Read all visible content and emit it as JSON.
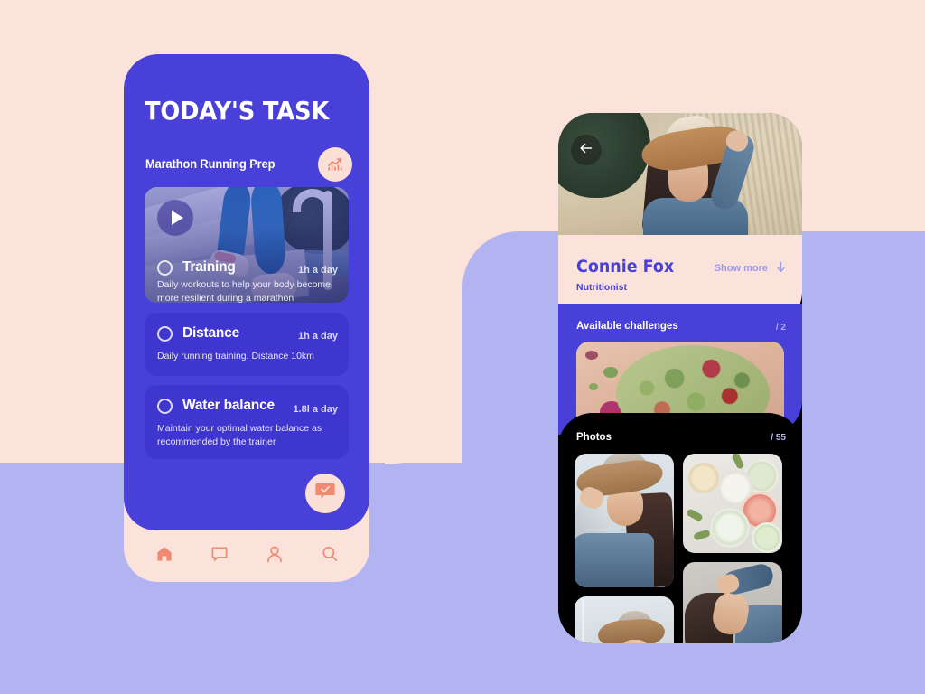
{
  "background": {
    "pink": "#FBE2DB",
    "lavender": "#B2B4F2"
  },
  "theme": {
    "indigo": "#4840D8",
    "indigo_card": "#3F35CF",
    "salmon": "#F08A70",
    "cream": "#FBE0D7",
    "black": "#000000"
  },
  "left_phone": {
    "header": {
      "title": "TODAY'S TASK",
      "subtitle": "Marathon Running Prep",
      "stats_icon": "trending-up-chart-icon"
    },
    "video_card": {
      "play_icon": "play-icon"
    },
    "tasks": [
      {
        "title": "Training",
        "meta": "1h a day",
        "description": "Daily workouts to help your body become more resilient during a marathon",
        "checkbox": "radio-unchecked-icon"
      },
      {
        "title": "Distance",
        "meta": "1h a day",
        "description": "Daily running training. Distance 10km",
        "checkbox": "radio-unchecked-icon"
      },
      {
        "title": "Water balance",
        "meta": "1.8l a day",
        "description": "Maintain your optimal water balance as recommended by the trainer",
        "checkbox": "radio-unchecked-icon"
      }
    ],
    "fab": {
      "icon": "chat-bubble-check-icon"
    },
    "nav_items": [
      {
        "icon": "home-icon",
        "active": true
      },
      {
        "icon": "chat-icon",
        "active": false
      },
      {
        "icon": "person-icon",
        "active": false
      },
      {
        "icon": "search-icon",
        "active": false
      }
    ]
  },
  "right_phone": {
    "hero": {
      "back_icon": "arrow-left-icon"
    },
    "profile": {
      "name": "Connie Fox",
      "role": "Nutritionist",
      "show_more_label": "Show more",
      "show_more_icon": "arrow-down-icon"
    },
    "challenges": {
      "heading": "Available challenges",
      "count": "/ 2"
    },
    "photos": {
      "heading": "Photos",
      "count": "/ 55"
    }
  }
}
